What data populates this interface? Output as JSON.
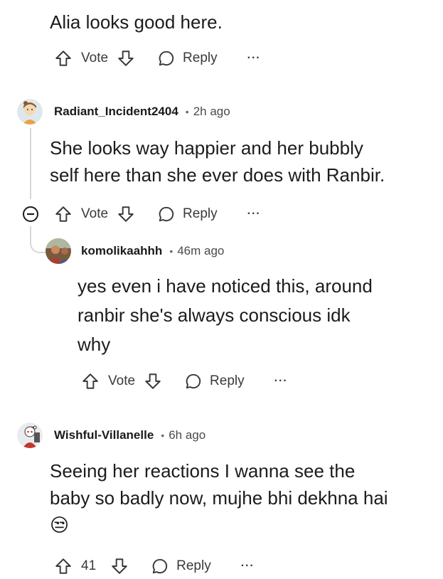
{
  "comments": [
    {
      "text": "Alia looks good here.",
      "actions": {
        "vote": "Vote",
        "reply": "Reply",
        "more": "···"
      }
    },
    {
      "username": "Radiant_Incident2404",
      "time": "2h ago",
      "text_lines": [
        "She looks way happier and her bubbly",
        "self here than she ever does with Ranbir."
      ],
      "actions": {
        "vote": "Vote",
        "reply": "Reply",
        "more": "···"
      }
    },
    {
      "username": "komolikaahhh",
      "time": "46m ago",
      "text_lines": [
        "yes even i have noticed this, around",
        "ranbir she's always conscious idk",
        "why"
      ],
      "actions": {
        "vote": "Vote",
        "reply": "Reply",
        "more": "···"
      }
    },
    {
      "username": "Wishful-Villanelle",
      "time": "6h ago",
      "text_lines": [
        "Seeing her reactions I wanna see the",
        "baby so badly now, mujhe bhi dekhna hai"
      ],
      "emoji": "😒",
      "actions": {
        "vote": "41",
        "reply": "Reply",
        "more": "···"
      }
    }
  ],
  "separator": "•",
  "icons": {
    "upvote": "upvote-icon",
    "downvote": "downvote-icon",
    "reply": "reply-bubble-icon",
    "collapse": "collapse-thread-icon",
    "more": "more-options-icon"
  },
  "colors": {
    "text": "#1c1c1c",
    "meta": "#4a4a4a",
    "icon": "#3a3a3c",
    "thread_line": "#d7d7d7"
  }
}
